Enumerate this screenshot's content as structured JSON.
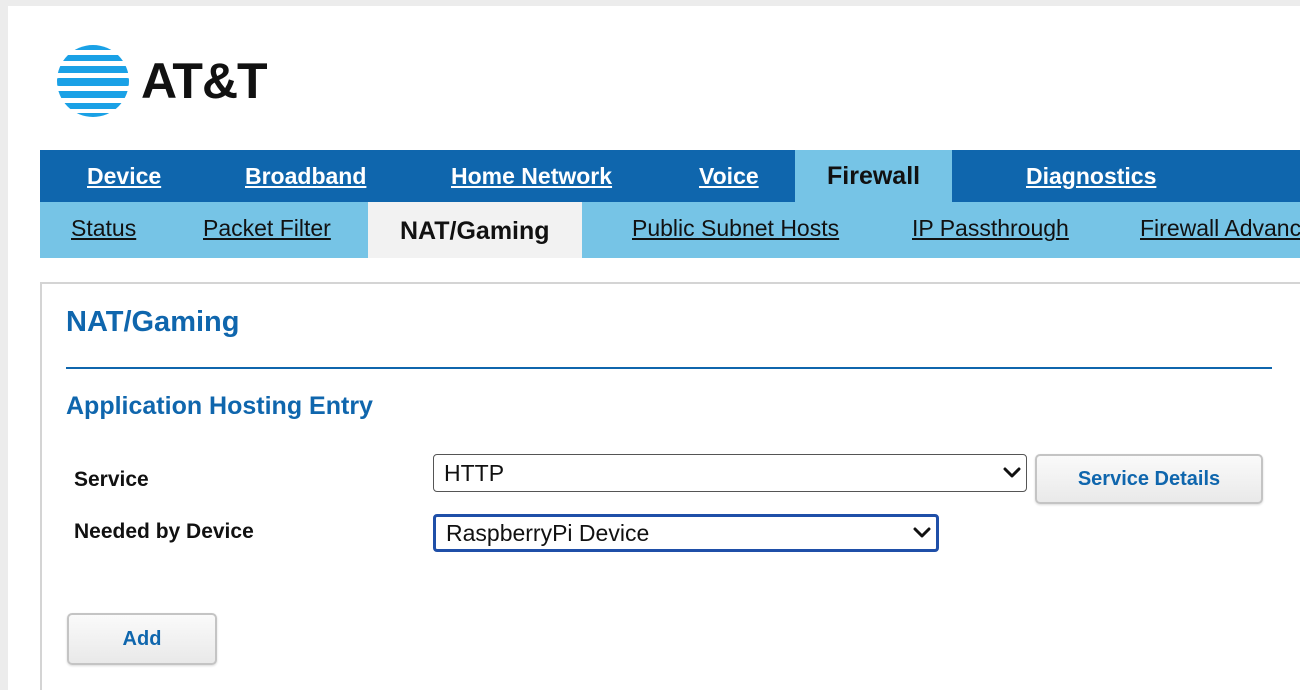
{
  "brand": {
    "name": "AT&T"
  },
  "main_nav": {
    "items": [
      {
        "label": "Device",
        "active": false
      },
      {
        "label": "Broadband",
        "active": false
      },
      {
        "label": "Home Network",
        "active": false
      },
      {
        "label": "Voice",
        "active": false
      },
      {
        "label": "Firewall",
        "active": true
      },
      {
        "label": "Diagnostics",
        "active": false
      }
    ]
  },
  "sub_nav": {
    "items": [
      {
        "label": "Status",
        "active": false
      },
      {
        "label": "Packet Filter",
        "active": false
      },
      {
        "label": "NAT/Gaming",
        "active": true
      },
      {
        "label": "Public Subnet Hosts",
        "active": false
      },
      {
        "label": "IP Passthrough",
        "active": false
      },
      {
        "label": "Firewall Advanced",
        "active": false
      }
    ]
  },
  "content": {
    "title": "NAT/Gaming",
    "section_title": "Application Hosting Entry",
    "service": {
      "label": "Service",
      "selected": "HTTP",
      "details_button": "Service Details"
    },
    "device": {
      "label": "Needed by Device",
      "selected": "RaspberryPi Device"
    },
    "add_button": "Add"
  },
  "colors": {
    "primary_blue": "#0f66ad",
    "light_blue": "#76c4e6",
    "active_sub_bg": "#f2f2f2"
  }
}
